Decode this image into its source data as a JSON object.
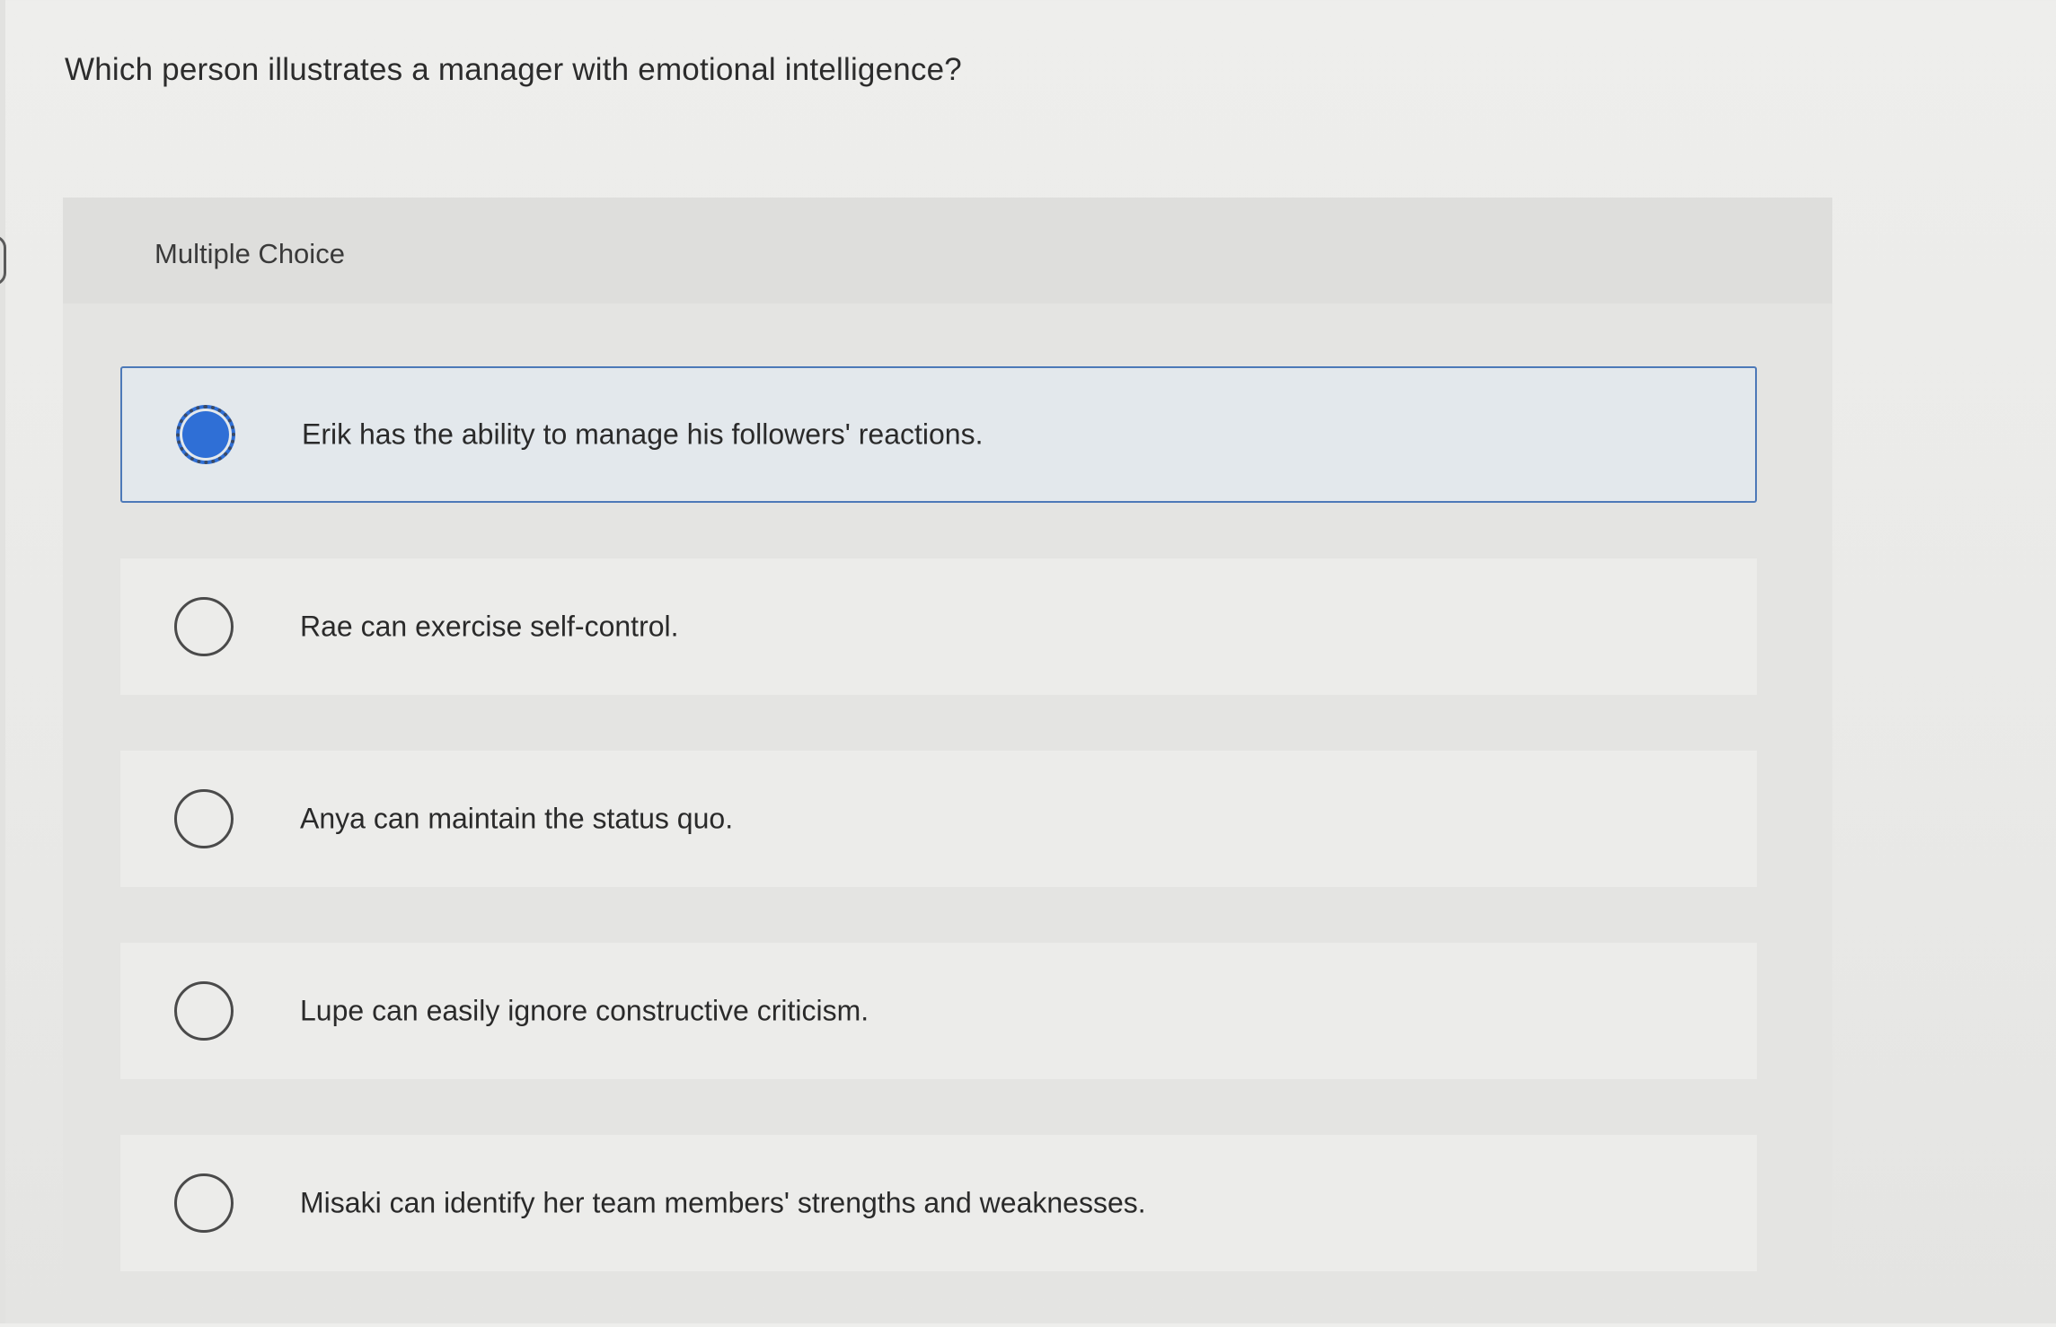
{
  "question": {
    "text": "Which person illustrates a manager with emotional intelligence?"
  },
  "panel": {
    "title": "Multiple Choice"
  },
  "choices": [
    {
      "label": "Erik has the ability to manage his followers' reactions.",
      "selected": true
    },
    {
      "label": "Rae can exercise self-control.",
      "selected": false
    },
    {
      "label": "Anya can maintain the status quo.",
      "selected": false
    },
    {
      "label": "Lupe can easily ignore constructive criticism.",
      "selected": false
    },
    {
      "label": "Misaki can identify her team members' strengths and weaknesses.",
      "selected": false
    }
  ],
  "colors": {
    "accent": "#2f6fd6",
    "selected_border": "#4d79b8",
    "selected_background": "#e3e8ec"
  }
}
